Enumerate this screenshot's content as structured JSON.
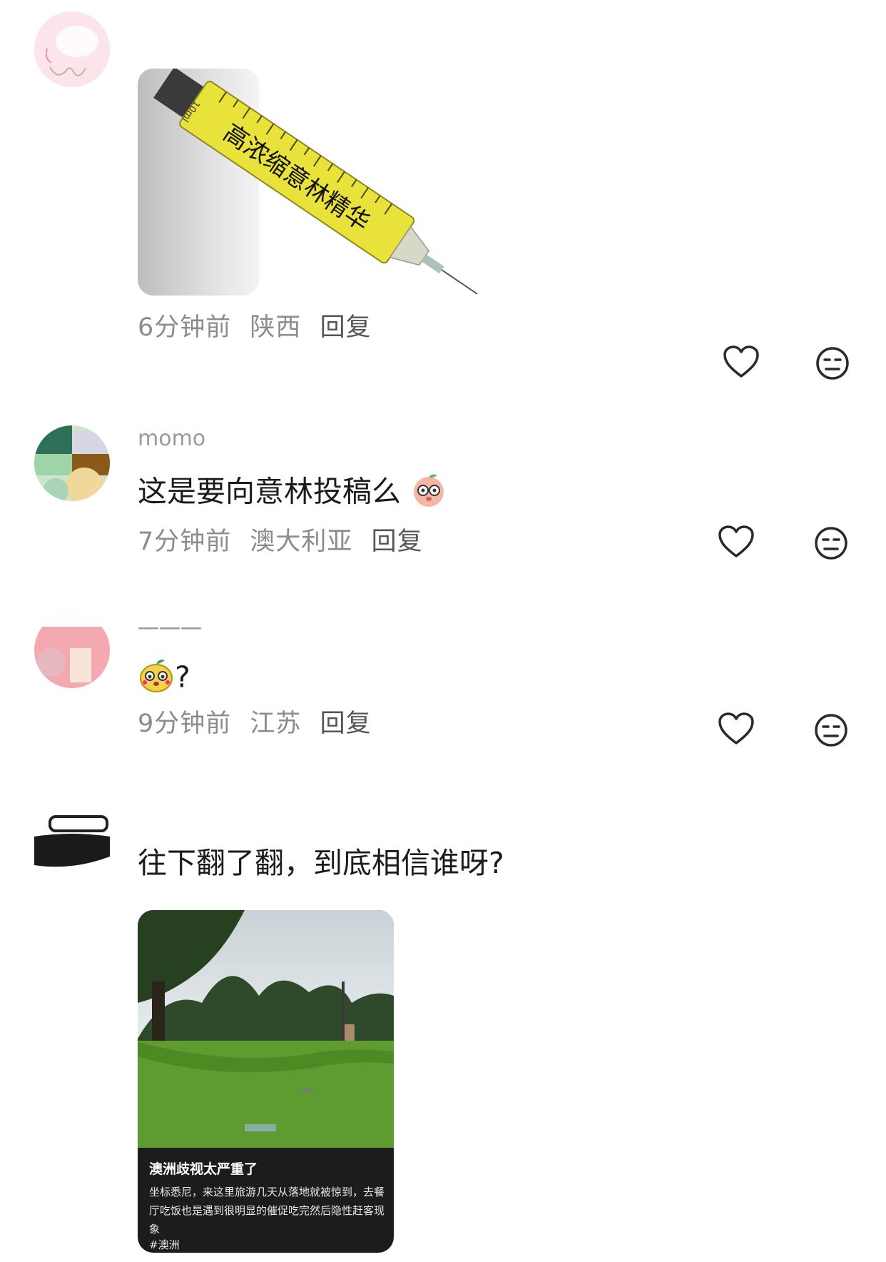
{
  "comments": [
    {
      "name": "",
      "text": "",
      "image_label": "高浓缩意林精华",
      "syringe_unit": "10ml",
      "time": "6分钟前",
      "location": "陕西",
      "reply": "回复"
    },
    {
      "name": "momo",
      "text": "这是要向意林投稿么",
      "time": "7分钟前",
      "location": "澳大利亚",
      "reply": "回复"
    },
    {
      "name": "一一一",
      "text": "?",
      "time": "9分钟前",
      "location": "江苏",
      "reply": "回复"
    },
    {
      "name": "",
      "text": "往下翻了翻，到底相信谁呀?",
      "card": {
        "title": "澳洲歧视太严重了",
        "body": "坐标悉尼，来这里旅游几天从落地就被惊到，去餐厅吃饭也是遇到很明显的催促吃完然后隐性赶客现象",
        "tag": "#澳洲"
      }
    }
  ],
  "icons": {
    "like": "heart-outline-icon",
    "dislike": "meh-face-icon"
  },
  "colors": {
    "meta_text": "#8c8c8c",
    "icon_stroke": "#2a2a2a",
    "syringe_fill": "#e9e23a"
  }
}
